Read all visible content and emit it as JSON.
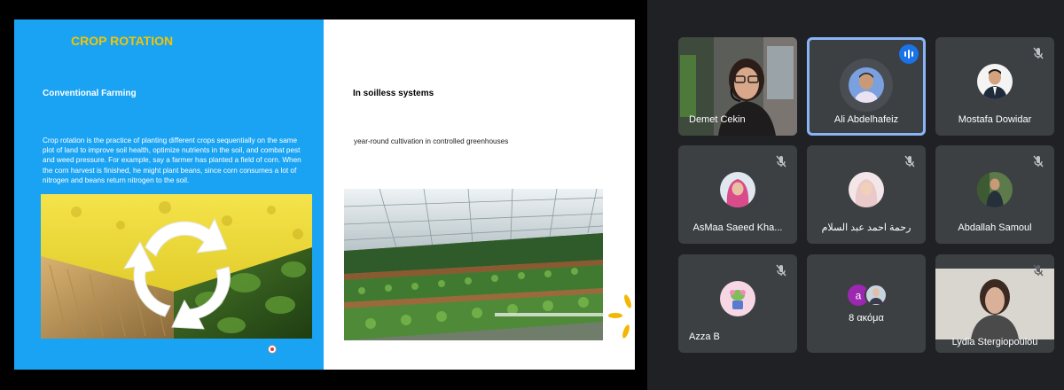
{
  "slide": {
    "title": "CROP ROTATION",
    "left_heading": "Conventional Farming",
    "left_body": "Crop rotation is the practice of planting different crops sequentially on the same plot of land to improve soil health, optimize nutrients in the soil, and combat pest and weed pressure. For example, say a farmer has planted a field of corn. When the corn harvest is finished, he might plant beans, since corn consumes a lot of nitrogen and beans return nitrogen to the soil.",
    "right_heading": "In soilless systems",
    "right_body": "year-round cultivation in controlled greenhouses",
    "colors": {
      "left_bg": "#1aa3f3",
      "title": "#f5c400",
      "right_bg": "#ffffff"
    }
  },
  "participants": [
    {
      "name": "Demet Cekin",
      "muted": false,
      "video": true
    },
    {
      "name": "Ali Abdelhafeiz",
      "speaking": true
    },
    {
      "name": "Mostafa Dowidar",
      "muted": true
    },
    {
      "name": "AsMaa Saeed Kha...",
      "muted": true
    },
    {
      "name": "رحمة احمد عبد السلام",
      "muted": true
    },
    {
      "name": "Abdallah Samoul",
      "muted": true
    },
    {
      "name": "Azza B",
      "muted": true
    },
    {
      "name": "8 ακόμα",
      "initial": "a"
    },
    {
      "name": "Lydia Stergiopoulou",
      "muted": true,
      "video": true
    }
  ],
  "icons": {
    "mute": "mic-off-icon",
    "speaking": "audio-bars-icon"
  },
  "accent": "#8ab4f8"
}
